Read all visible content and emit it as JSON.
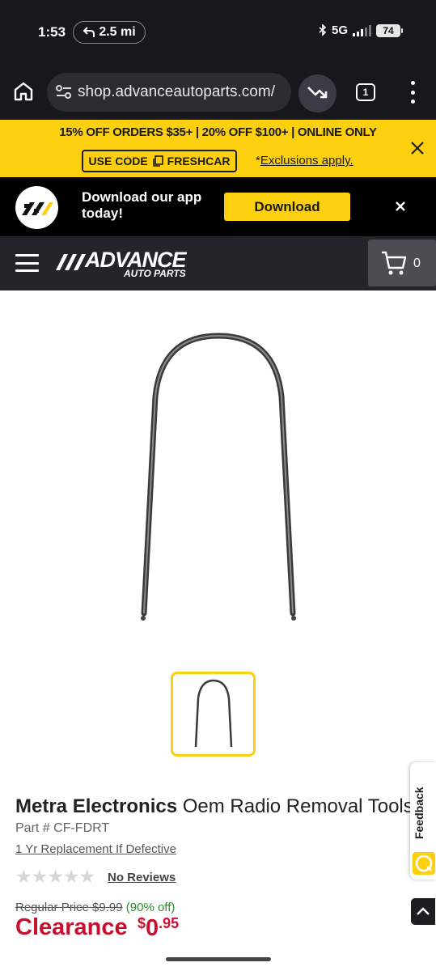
{
  "status_bar": {
    "time": "1:53",
    "nav_distance": "2.5 mi",
    "network": "5G",
    "battery": "74"
  },
  "browser": {
    "url": "shop.advanceautoparts.com/",
    "tab_count": "1"
  },
  "promo": {
    "headline": "15% OFF ORDERS $35+ | 20% OFF $100+ | ONLINE ONLY",
    "code_prefix": "USE CODE",
    "code": "FRESHCAR",
    "exclusions_asterisk": "*",
    "exclusions_link": "Exclusions apply."
  },
  "app_banner": {
    "text": "Download our app today!",
    "button": "Download"
  },
  "header": {
    "logo_main": "ADVANCE",
    "logo_sub": "AUTO PARTS",
    "cart_count": "0"
  },
  "product": {
    "brand": "Metra Electronics",
    "name": " Oem Radio Removal Tools",
    "part": "Part # CF-FDRT",
    "warranty": "1 Yr Replacement If Defective",
    "rating_stars": 0,
    "reviews": "No Reviews",
    "regular_label": "Regular Price",
    "regular_price": "$9.99",
    "discount": "(90% off)",
    "clearance_label": "Clearance",
    "price_symbol": "$",
    "price_dollars": "0",
    "price_cents": ".95"
  },
  "feedback": {
    "label": "Feedback"
  },
  "colors": {
    "brand_yellow": "#fcd00f",
    "clearance_red": "#c8102e",
    "discount_green": "#2e8b2e"
  }
}
